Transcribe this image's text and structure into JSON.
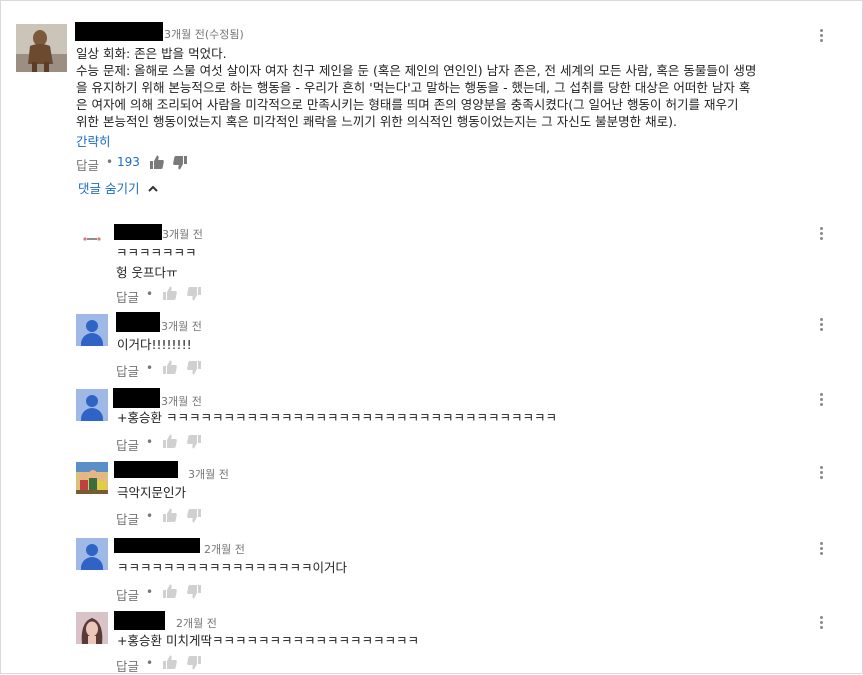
{
  "comment": {
    "time": "3개월 전(수정됨)",
    "lines": [
      "일상 회화: 존은 밥을 먹었다.",
      "수능 문제: 올해로 스물 여섯 살이자 여자 친구 제인을 둔 (혹은 제인의 연인인) 남자 존은, 전 세계의 모든 사람, 혹은 동물들이 생명",
      "을 유지하기 위해 본능적으로 하는 행동을 - 우리가 흔히 '먹는다'고 말하는 행동을 - 했는데, 그 섭취를 당한 대상은 어떠한 남자 혹",
      "은 여자에 의해 조리되어 사람을 미각적으로 만족시키는 형태를 띄며 존의 영양분을 충족시켰다(그 일어난 행동이 허기를 재우기",
      "위한 본능적인 행동이었는지 혹은 미각적인 쾌락을 느끼기 위한 의식적인 행동이었는지는 그 자신도 불분명한 채로)."
    ],
    "collapse_label": "간략히",
    "reply_label": "답글",
    "separator": "•",
    "like_count": "193",
    "hide_replies_label": "댓글 숨기기"
  },
  "replies": [
    {
      "time": "3개월 전",
      "lines": [
        "ㅋㅋㅋㅋㅋㅋㅋ",
        "헝 웃프다ㅠ"
      ],
      "reply_label": "답글",
      "separator": "•"
    },
    {
      "time": "3개월 전",
      "lines": [
        "이거다!!!!!!!!"
      ],
      "reply_label": "답글",
      "separator": "•"
    },
    {
      "time": "3개월 전",
      "lines": [
        "+홍승환 ㅋㅋㅋㅋㅋㅋㅋㅋㅋㅋㅋㅋㅋㅋㅋㅋㅋㅋㅋㅋㅋㅋㅋㅋㅋㅋㅋㅋㅋㅋㅋㅋㅋㅋ"
      ],
      "reply_label": "답글",
      "separator": "•"
    },
    {
      "time": "3개월 전",
      "lines": [
        "극악지문인가"
      ],
      "reply_label": "답글",
      "separator": "•"
    },
    {
      "time": "2개월 전",
      "lines": [
        "ㅋㅋㅋㅋㅋㅋㅋㅋㅋㅋㅋㅋㅋㅋㅋㅋㅋ이거다"
      ],
      "reply_label": "답글",
      "separator": "•"
    },
    {
      "time": "2개월 전",
      "lines": [
        "+홍승환 미치게딱ㅋㅋㅋㅋㅋㅋㅋㅋㅋㅋㅋㅋㅋㅋㅋㅋㅋㅋ"
      ],
      "reply_label": "답글",
      "separator": "•"
    }
  ]
}
